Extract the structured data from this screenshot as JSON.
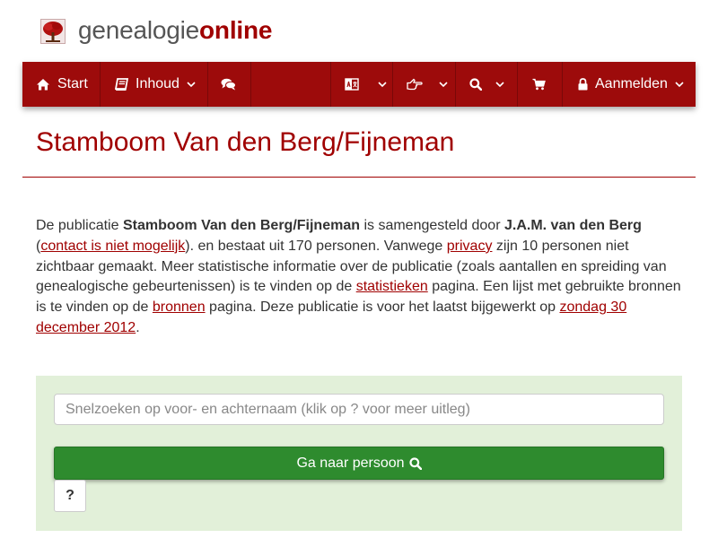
{
  "logo": {
    "text_part1": "genealogie",
    "text_part2": "online",
    "icon": "tree-icon"
  },
  "nav": {
    "start_label": "Start",
    "inhoud_label": "Inhoud",
    "aanmelden_label": "Aanmelden",
    "icons": [
      "home-icon",
      "book-icon",
      "comments-icon",
      "language-icon",
      "hand-point-right-icon",
      "search-icon",
      "shopping-cart-icon",
      "lock-icon"
    ]
  },
  "page": {
    "title": "Stamboom Van den Berg/Fijneman"
  },
  "intro": {
    "t1": "De publicatie ",
    "pub_name": "Stamboom Van den Berg/Fijneman",
    "t2": " is samengesteld door ",
    "author": "J.A.M. van den Berg",
    "t3": " (",
    "contact_link": "contact is niet mogelijk",
    "t4": "). en bestaat uit 170 personen. Vanwege ",
    "privacy_link": "privacy",
    "t5": " zijn 10 personen niet zichtbaar gemaakt. Meer statistische informatie over de publicatie (zoals aantallen en spreiding van genealogische gebeurtenissen) is te vinden op de ",
    "stats_link": "statistieken",
    "t6": " pagina. Een lijst met gebruikte bronnen is te vinden op de ",
    "sources_link": "bronnen",
    "t7": " pagina. Deze publicatie is voor het laatst bijgewerkt op ",
    "date_link": "zondag 30 december 2012",
    "t8": "."
  },
  "search": {
    "placeholder": "Snelzoeken op voor- en achternaam (klik op ? voor meer uitleg)",
    "value": "",
    "go_label": "Ga naar persoon",
    "help_label": "?"
  },
  "colors": {
    "brand": "#9d0b0b",
    "link": "#a00000",
    "panel_bg": "#e2f0d9",
    "button_green": "#2e8b2e"
  }
}
